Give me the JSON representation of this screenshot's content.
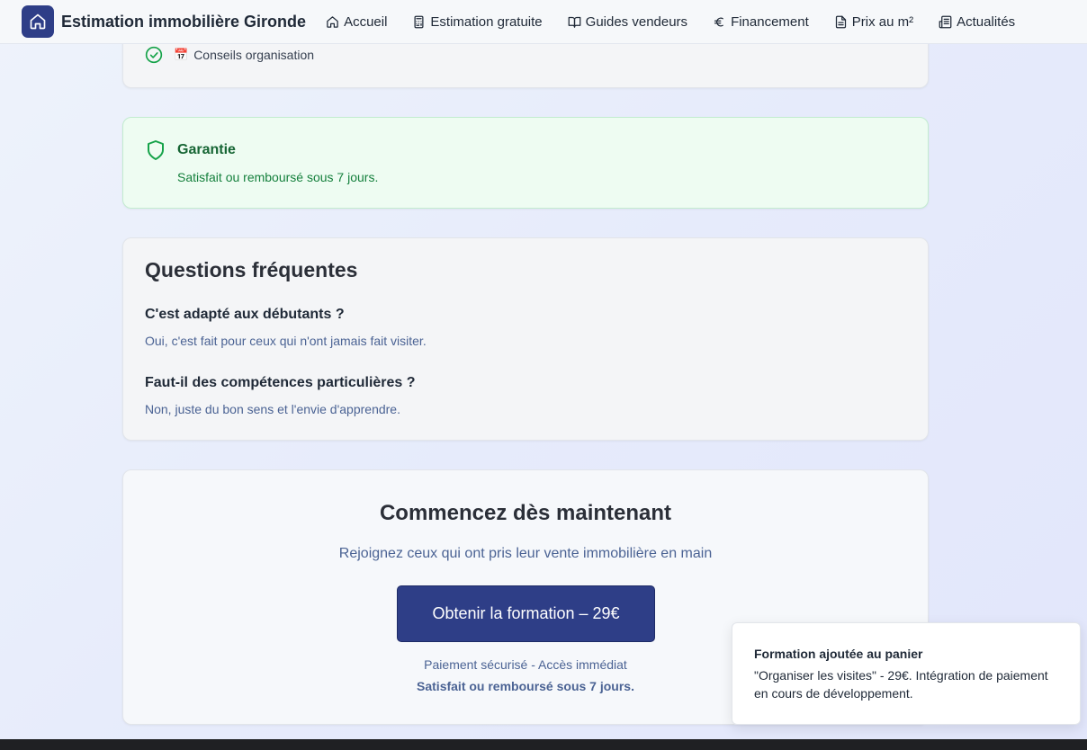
{
  "navbar": {
    "brand_title": "Estimation immobilière Gironde",
    "brand_icon": "home-icon",
    "items": [
      {
        "label": "Accueil",
        "icon": "home-icon"
      },
      {
        "label": "Estimation gratuite",
        "icon": "calculator-icon"
      },
      {
        "label": "Guides vendeurs",
        "icon": "book-open-icon"
      },
      {
        "label": "Financement",
        "icon": "euro-icon"
      },
      {
        "label": "Prix au m²",
        "icon": "file-text-icon"
      },
      {
        "label": "Actualités",
        "icon": "newspaper-icon"
      }
    ]
  },
  "features": {
    "last_item": "Conseils organisation",
    "last_item_emoji": "📅"
  },
  "guarantee": {
    "title": "Garantie",
    "text": "Satisfait ou remboursé sous 7 jours."
  },
  "faq": {
    "title": "Questions fréquentes",
    "items": [
      {
        "question": "C'est adapté aux débutants ?",
        "answer": "Oui, c'est fait pour ceux qui n'ont jamais fait visiter."
      },
      {
        "question": "Faut-il des compétences particulières ?",
        "answer": "Non, juste du bon sens et l'envie d'apprendre."
      }
    ]
  },
  "cta": {
    "title": "Commencez dès maintenant",
    "subtitle": "Rejoignez ceux qui ont pris leur vente immobilière en main",
    "button_label": "Obtenir la formation – 29€",
    "note": "Paiement sécurisé - Accès immédiat",
    "guarantee": "Satisfait ou remboursé sous 7 jours."
  },
  "toast": {
    "title": "Formation ajoutée au panier",
    "text": "\"Organiser les visites\" - 29€. Intégration de paiement en cours de développement."
  },
  "colors": {
    "brand": "#2e3e87",
    "success": "#16a34a",
    "muted_text": "#4b6394"
  }
}
